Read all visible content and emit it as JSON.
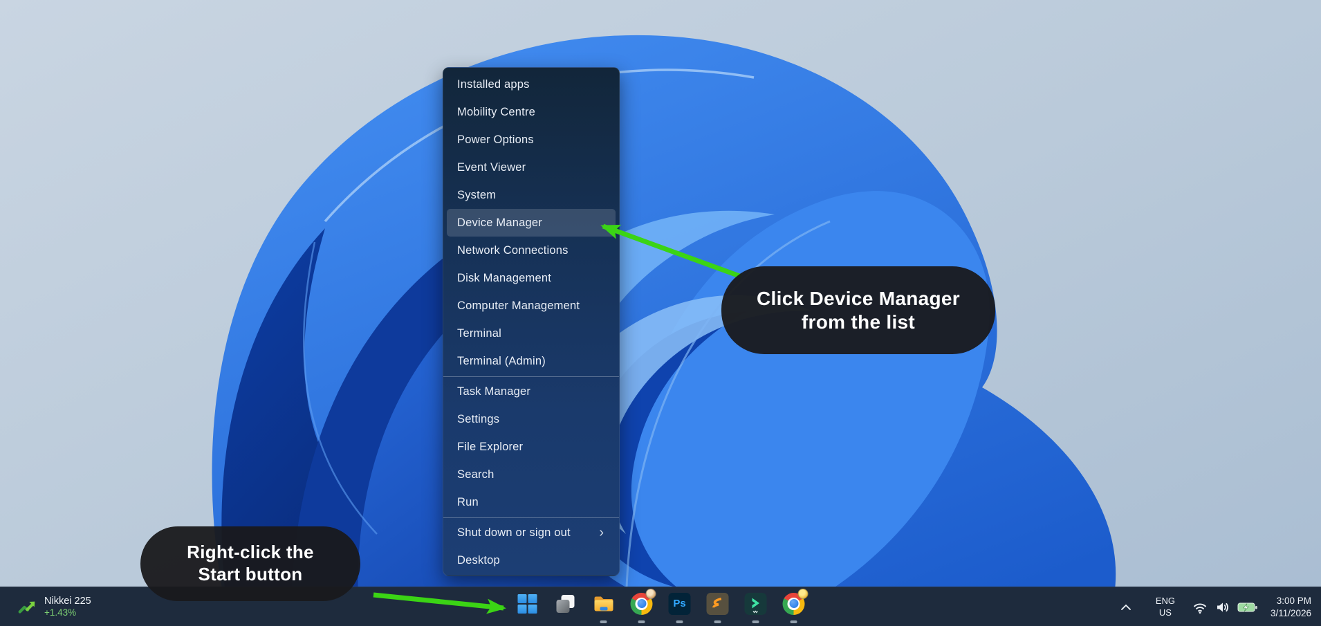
{
  "menu": {
    "items": [
      {
        "label": "Installed apps"
      },
      {
        "label": "Mobility Centre"
      },
      {
        "label": "Power Options"
      },
      {
        "label": "Event Viewer"
      },
      {
        "label": "System"
      },
      {
        "label": "Device Manager",
        "highlighted": true
      },
      {
        "label": "Network Connections"
      },
      {
        "label": "Disk Management"
      },
      {
        "label": "Computer Management"
      },
      {
        "label": "Terminal"
      },
      {
        "label": "Terminal (Admin)"
      },
      {
        "label": "Task Manager"
      },
      {
        "label": "Settings"
      },
      {
        "label": "File Explorer"
      },
      {
        "label": "Search"
      },
      {
        "label": "Run"
      },
      {
        "label": "Shut down or sign out",
        "chevron": "›"
      },
      {
        "label": "Desktop"
      }
    ]
  },
  "callouts": {
    "device_manager": {
      "line1": "Click Device Manager",
      "line2": "from the list"
    },
    "start_button": {
      "line1": "Right-click the",
      "line2": "Start button"
    }
  },
  "taskbar": {
    "widget": {
      "title": "Nikkei 225",
      "change": "+1.43%"
    },
    "icons": [
      {
        "name": "start"
      },
      {
        "name": "task-view"
      },
      {
        "name": "file-explorer",
        "running": true
      },
      {
        "name": "chrome-profile-1",
        "running": true
      },
      {
        "name": "photoshop",
        "label": "Ps",
        "running": true
      },
      {
        "name": "sublime-text",
        "running": true
      },
      {
        "name": "wondershare",
        "running": true
      },
      {
        "name": "chrome-profile-2",
        "running": true
      }
    ],
    "tray": {
      "language_top": "ENG",
      "language_bottom": "US",
      "time": "3:00 PM",
      "date": "3/11/2026"
    }
  },
  "colors": {
    "arrow_green": "#3bd415",
    "callout_bg": "#19191c",
    "taskbar_bg": "#1e2b3d",
    "menu_highlight": "rgba(255,255,255,0.15)",
    "widget_change_green": "#7ccf72",
    "photoshop_blue": "#31a8ff",
    "bloom_blue": "#2b74e4"
  }
}
